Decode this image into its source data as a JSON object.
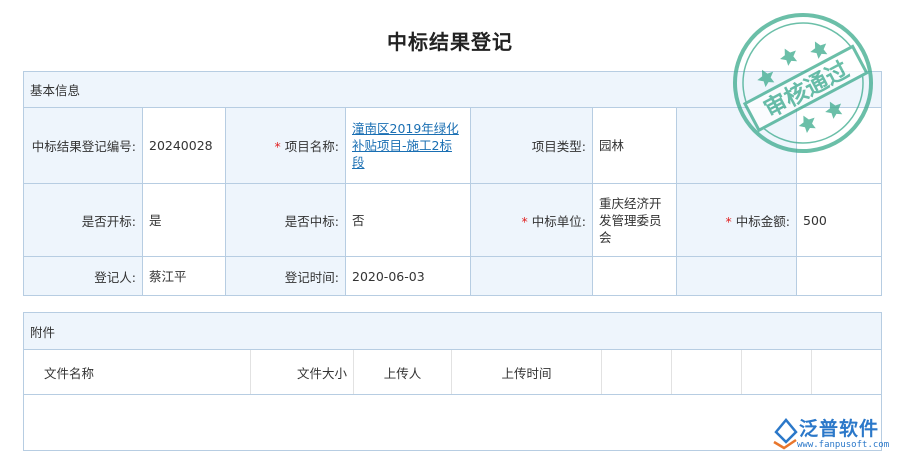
{
  "page_title": "中标结果登记",
  "basic_info": {
    "section_title": "基本信息",
    "fields": {
      "reg_no_label": "中标结果登记编号:",
      "reg_no_value": "20240028",
      "project_name_label": "项目名称:",
      "project_name_value": "潼南区2019年绿化补贴项目-施工2标段",
      "project_type_label": "项目类型:",
      "project_type_value": "园林",
      "is_open_label": "是否开标:",
      "is_open_value": "是",
      "is_won_label": "是否中标:",
      "is_won_value": "否",
      "win_unit_label": "中标单位:",
      "win_unit_value": "重庆经济开发管理委员会",
      "win_amount_label": "中标金额:",
      "win_amount_value": "500",
      "registrant_label": "登记人:",
      "registrant_value": "蔡江平",
      "reg_time_label": "登记时间:",
      "reg_time_value": "2020-06-03"
    },
    "required_mark": "*"
  },
  "attachments": {
    "section_title": "附件",
    "columns": [
      "文件名称",
      "文件大小",
      "上传人",
      "上传时间"
    ]
  },
  "stamp": {
    "text": "审核通过",
    "color": "#3aaa8c"
  },
  "brand": {
    "name": "泛普软件",
    "url": "www.fanpusoft.com",
    "color": "#2b78c9"
  }
}
